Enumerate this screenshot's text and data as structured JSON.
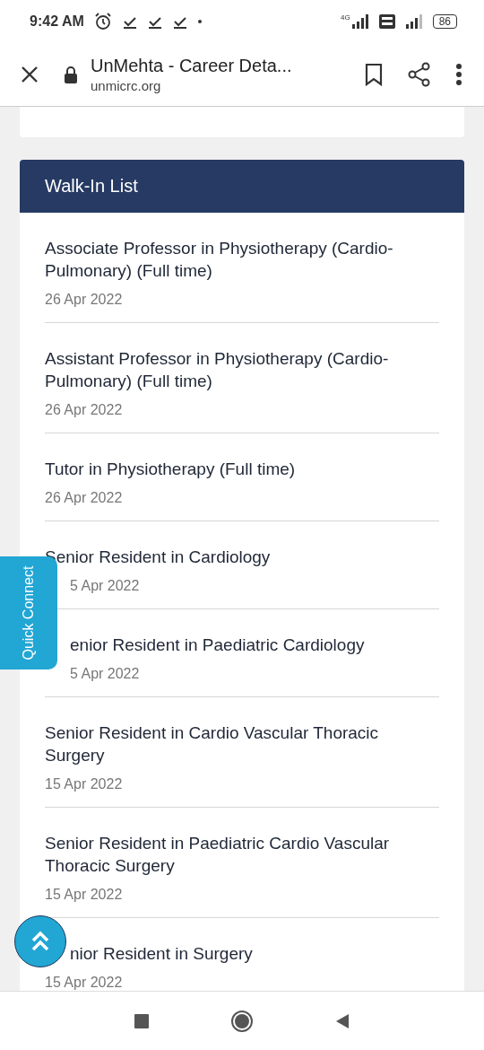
{
  "status_bar": {
    "time": "9:42 AM",
    "network": "4G",
    "battery": "86"
  },
  "browser": {
    "title": "UnMehta - Career Deta...",
    "url": "unmicrc.org"
  },
  "walkin": {
    "heading": "Walk-In List",
    "items": [
      {
        "title": "Associate Professor in Physiotherapy (Cardio-Pulmonary) (Full time)",
        "date": "26 Apr 2022",
        "title_cut": false,
        "date_cut": false
      },
      {
        "title": "Assistant Professor in Physiotherapy (Cardio-Pulmonary) (Full time)",
        "date": "26 Apr 2022",
        "title_cut": false,
        "date_cut": false
      },
      {
        "title": "Tutor in Physiotherapy (Full time)",
        "date": "26 Apr 2022",
        "title_cut": false,
        "date_cut": false
      },
      {
        "title": "Senior Resident in Cardiology",
        "date": "5 Apr 2022",
        "title_cut": false,
        "date_cut": true
      },
      {
        "title": "enior Resident in Paediatric Cardiology",
        "date": "5 Apr 2022",
        "title_cut": true,
        "date_cut": true
      },
      {
        "title": "Senior Resident in Cardio Vascular Thoracic Surgery",
        "date": "15 Apr 2022",
        "title_cut": false,
        "date_cut": false
      },
      {
        "title": "Senior Resident in Paediatric Cardio Vascular Thoracic Surgery",
        "date": "15 Apr 2022",
        "title_cut": false,
        "date_cut": false
      },
      {
        "title": "nior Resident in Surgery",
        "date": "15 Apr 2022",
        "title_cut": true,
        "date_cut": false
      }
    ]
  },
  "quick_connect": "Quick Connect"
}
